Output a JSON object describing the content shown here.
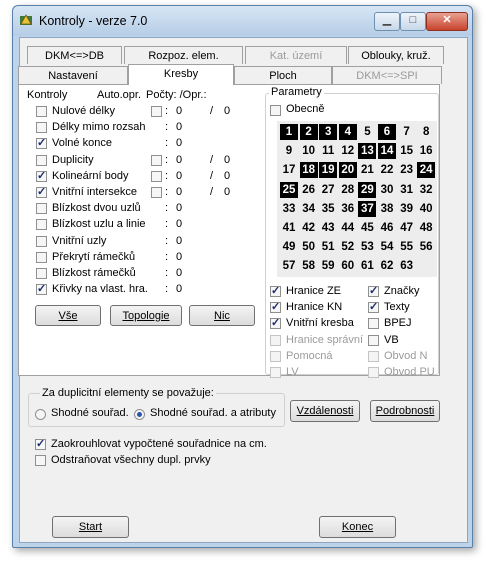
{
  "window": {
    "title": "Kontroly - verze 7.0"
  },
  "tabs_row1": [
    {
      "label": "DKM<=>DB",
      "state": "normal"
    },
    {
      "label": "Rozpoz. elem.",
      "state": "normal"
    },
    {
      "label": "Kat. území",
      "state": "disabled"
    },
    {
      "label": "Oblouky, kruž.",
      "state": "normal"
    }
  ],
  "tabs_row2": [
    {
      "label": "Nastavení",
      "state": "normal"
    },
    {
      "label": "Kresby",
      "state": "active"
    },
    {
      "label": "Ploch",
      "state": "normal"
    },
    {
      "label": "DKM<=>SPI",
      "state": "disabled"
    }
  ],
  "kontroly": {
    "header": {
      "kontroly": "Kontroly",
      "auto": "Auto.opr.",
      "pocty": "Počty: /Opr.:"
    },
    "rows": [
      {
        "label": "Nulové délky",
        "checked": false,
        "auto": true,
        "count": "0",
        "fixed": "0"
      },
      {
        "label": "Délky mimo rozsah",
        "checked": false,
        "auto": false,
        "count": "0",
        "fixed": ""
      },
      {
        "label": "Volné konce",
        "checked": true,
        "auto": false,
        "count": "0",
        "fixed": ""
      },
      {
        "label": "Duplicity",
        "checked": false,
        "auto": true,
        "count": "0",
        "fixed": "0"
      },
      {
        "label": "Kolineární body",
        "checked": true,
        "auto": true,
        "count": "0",
        "fixed": "0"
      },
      {
        "label": "Vnitřní intersekce",
        "checked": true,
        "auto": true,
        "count": "0",
        "fixed": "0"
      },
      {
        "label": "Blízkost dvou uzlů",
        "checked": false,
        "auto": false,
        "count": "0",
        "fixed": ""
      },
      {
        "label": "Blízkost uzlu a linie",
        "checked": false,
        "auto": false,
        "count": "0",
        "fixed": ""
      },
      {
        "label": "Vnitřní uzly",
        "checked": false,
        "auto": false,
        "count": "0",
        "fixed": ""
      },
      {
        "label": "Překrytí rámečků",
        "checked": false,
        "auto": false,
        "count": "0",
        "fixed": ""
      },
      {
        "label": "Blízkost rámečků",
        "checked": false,
        "auto": false,
        "count": "0",
        "fixed": ""
      },
      {
        "label": "Křivky na vlast. hra.",
        "checked": true,
        "auto": false,
        "count": "0",
        "fixed": ""
      }
    ],
    "buttons": {
      "vse": "Vše",
      "topologie": "Topologie",
      "nic": "Nic"
    }
  },
  "parametry": {
    "title": "Parametry",
    "obecne": "Obecně",
    "grid": [
      [
        "1",
        "2",
        "3",
        "4",
        "5",
        "6",
        "7",
        "8"
      ],
      [
        "9",
        "10",
        "11",
        "12",
        "13",
        "14",
        "15",
        "16"
      ],
      [
        "17",
        "18",
        "19",
        "20",
        "21",
        "22",
        "23",
        "24"
      ],
      [
        "25",
        "26",
        "27",
        "28",
        "29",
        "30",
        "31",
        "32"
      ],
      [
        "33",
        "34",
        "35",
        "36",
        "37",
        "38",
        "39",
        "40"
      ],
      [
        "41",
        "42",
        "43",
        "44",
        "45",
        "46",
        "47",
        "48"
      ],
      [
        "49",
        "50",
        "51",
        "52",
        "53",
        "54",
        "55",
        "56"
      ],
      [
        "57",
        "58",
        "59",
        "60",
        "61",
        "62",
        "63",
        ""
      ]
    ],
    "selected": [
      "1",
      "2",
      "3",
      "4",
      "6",
      "13",
      "14",
      "18",
      "19",
      "20",
      "24",
      "25",
      "29",
      "37"
    ],
    "options_left": [
      {
        "label": "Hranice ZE",
        "checked": true,
        "enabled": true
      },
      {
        "label": "Hranice KN",
        "checked": true,
        "enabled": true
      },
      {
        "label": "Vnitřní kresba",
        "checked": true,
        "enabled": true
      },
      {
        "label": "Hranice správní",
        "checked": false,
        "enabled": false
      },
      {
        "label": "Pomocná",
        "checked": false,
        "enabled": false
      },
      {
        "label": "LV",
        "checked": false,
        "enabled": false
      }
    ],
    "options_right": [
      {
        "label": "Značky",
        "checked": true,
        "enabled": true
      },
      {
        "label": "Texty",
        "checked": true,
        "enabled": true
      },
      {
        "label": "BPEJ",
        "checked": false,
        "enabled": true
      },
      {
        "label": "VB",
        "checked": false,
        "enabled": true
      },
      {
        "label": "Obvod N",
        "checked": false,
        "enabled": false
      },
      {
        "label": "Obvod PU",
        "checked": false,
        "enabled": false
      }
    ]
  },
  "duplicates": {
    "title": "Za duplicitní elementy se považuje:",
    "radio1": "Shodné souřad.",
    "radio2": "Shodné souřad. a atributy",
    "selected": "radio2"
  },
  "buttons": {
    "vzdalenosti": "Vzdálenosti",
    "podrobnosti": "Podrobnosti",
    "start": "Start",
    "konec": "Konec"
  },
  "bottom_options": [
    {
      "label": "Zaokrouhlovat vypočtené souřadnice na cm.",
      "checked": true
    },
    {
      "label": "Odstraňovat všechny dupl. prvky",
      "checked": false
    }
  ]
}
